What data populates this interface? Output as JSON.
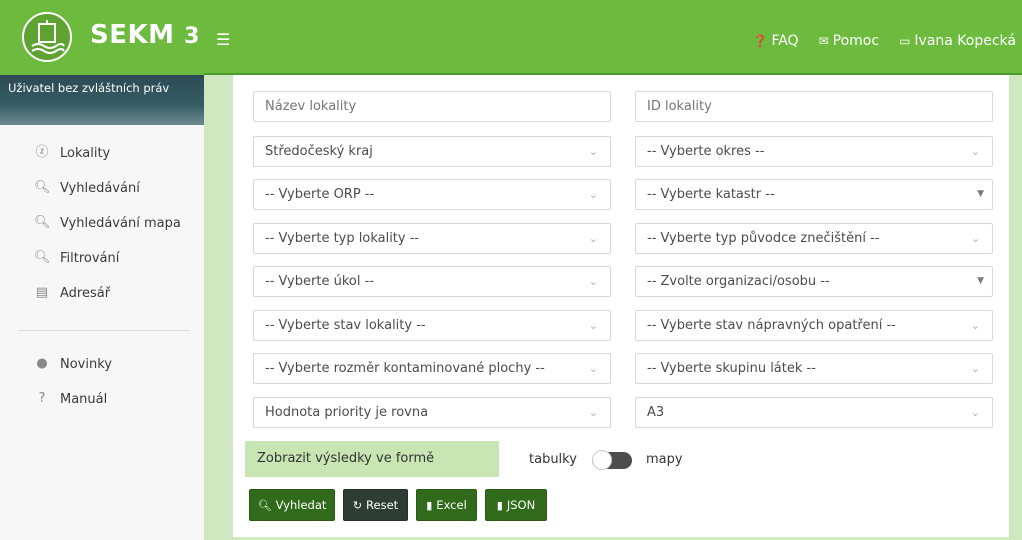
{
  "app": {
    "title": "SEKM",
    "version": "3"
  },
  "sidebar": {
    "user_role": "Uživatel bez zvláštních práv",
    "menu": [
      {
        "label": "Lokality",
        "icon": "lokality-icon"
      },
      {
        "label": "Vyhledávání",
        "icon": "search-icon"
      },
      {
        "label": "Vyhledávání mapa",
        "icon": "search-icon"
      },
      {
        "label": "Filtrování",
        "icon": "search-icon"
      },
      {
        "label": "Adresář",
        "icon": "book-icon"
      }
    ],
    "menu2": [
      {
        "label": "Novinky",
        "icon": "news-icon"
      },
      {
        "label": "Manuál",
        "icon": "help-icon"
      }
    ]
  },
  "topbar": {
    "faq": "FAQ",
    "help": "Pomoc",
    "user": "Ivana Kopecká"
  },
  "form": {
    "nazev_placeholder": "Název lokality",
    "id_placeholder": "ID lokality",
    "kraj": "Středočeský kraj",
    "okres": "-- Vyberte okres --",
    "orp": "-- Vyberte ORP --",
    "katastr": "-- Vyberte katastr --",
    "typ_lokality": "-- Vyberte typ lokality --",
    "typ_puvodce": "-- Vyberte typ původce znečištění --",
    "ukol": "-- Vyberte úkol --",
    "organizace": "-- Zvolte organizaci/osobu --",
    "stav_lokality": "-- Vyberte stav lokality --",
    "stav_opatreni": "-- Vyberte stav nápravných opatření --",
    "rozmer": "-- Vyberte rozměr kontaminované plochy --",
    "latky": "-- Vyberte skupinu látek --",
    "priorita": "Hodnota priority je rovna",
    "priorita_value": "A3"
  },
  "results": {
    "label": "Zobrazit výsledky ve formě",
    "left": "tabulky",
    "right": "mapy"
  },
  "buttons": {
    "search": "Vyhledat",
    "reset": "Reset",
    "excel": "Excel",
    "json": "JSON"
  },
  "colors": {
    "primary_green": "#6dbb3e",
    "button_green": "#2f6b1a",
    "content_bg": "#cfe8bf"
  }
}
